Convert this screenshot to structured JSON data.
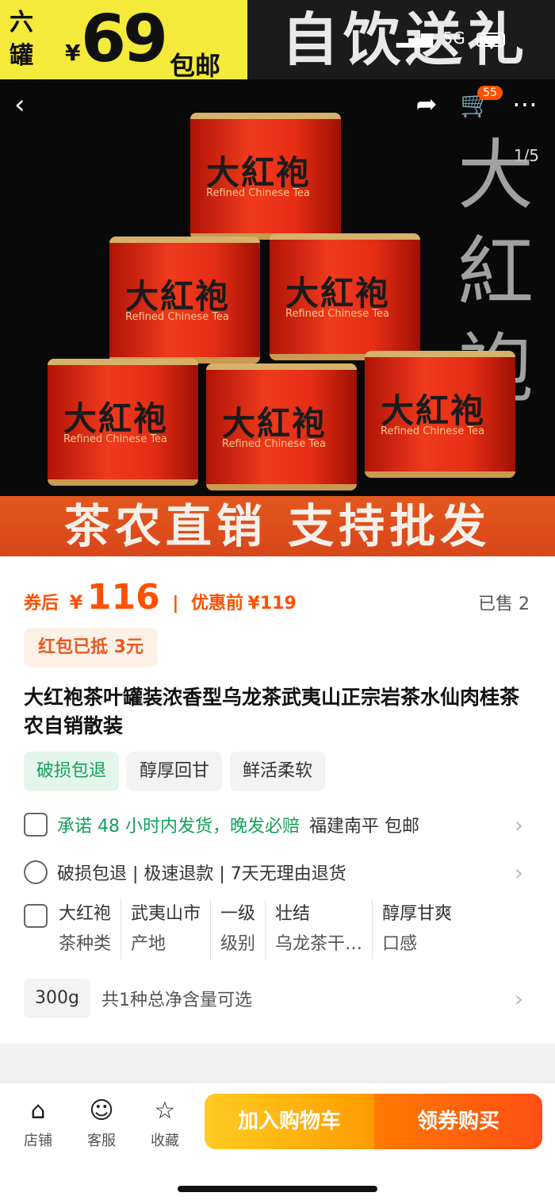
{
  "banner": {
    "promo_col": "六 罐",
    "yen": "¥",
    "price": "69",
    "free_shipping": "包邮",
    "slogan": "自饮送礼",
    "status_network": "5G"
  },
  "hero": {
    "page_indicator": "1/5",
    "cart_count": "55",
    "brush_text": "大 紅 袍",
    "can_cn": "大紅袍",
    "can_en": "Refined Chinese Tea",
    "ribbon": "茶农直销  支持批发"
  },
  "product": {
    "after_coupon_label": "券后",
    "yen": "¥",
    "price": "116",
    "separator": "|",
    "before_label": "优惠前",
    "original_price": "¥119",
    "sold": "已售 2",
    "red_packet": "红包已抵 3元",
    "title": "大红袍茶叶罐装浓香型乌龙茶武夷山正宗岩茶水仙肉桂茶农自销散装",
    "tags": [
      "破损包退",
      "醇厚回甘",
      "鲜活柔软"
    ],
    "delivery_promise": "承诺 48 小时内发货，晚发必赔",
    "delivery_location": "福建南平  包邮",
    "service": "破损包退 | 极速退款 | 7天无理由退货",
    "specs": [
      {
        "v": "大红袍",
        "k": "茶种类"
      },
      {
        "v": "武夷山市",
        "k": "产地"
      },
      {
        "v": "一级",
        "k": "级别"
      },
      {
        "v": "壮结",
        "k": "乌龙茶干…"
      },
      {
        "v": "醇厚甘爽",
        "k": "口感"
      }
    ],
    "option_chip": "300g",
    "option_text": "共1种总净含量可选"
  },
  "bottom_bar": {
    "shop": "店铺",
    "service": "客服",
    "favorite": "收藏",
    "add_cart": "加入购物车",
    "buy": "领券购买"
  }
}
